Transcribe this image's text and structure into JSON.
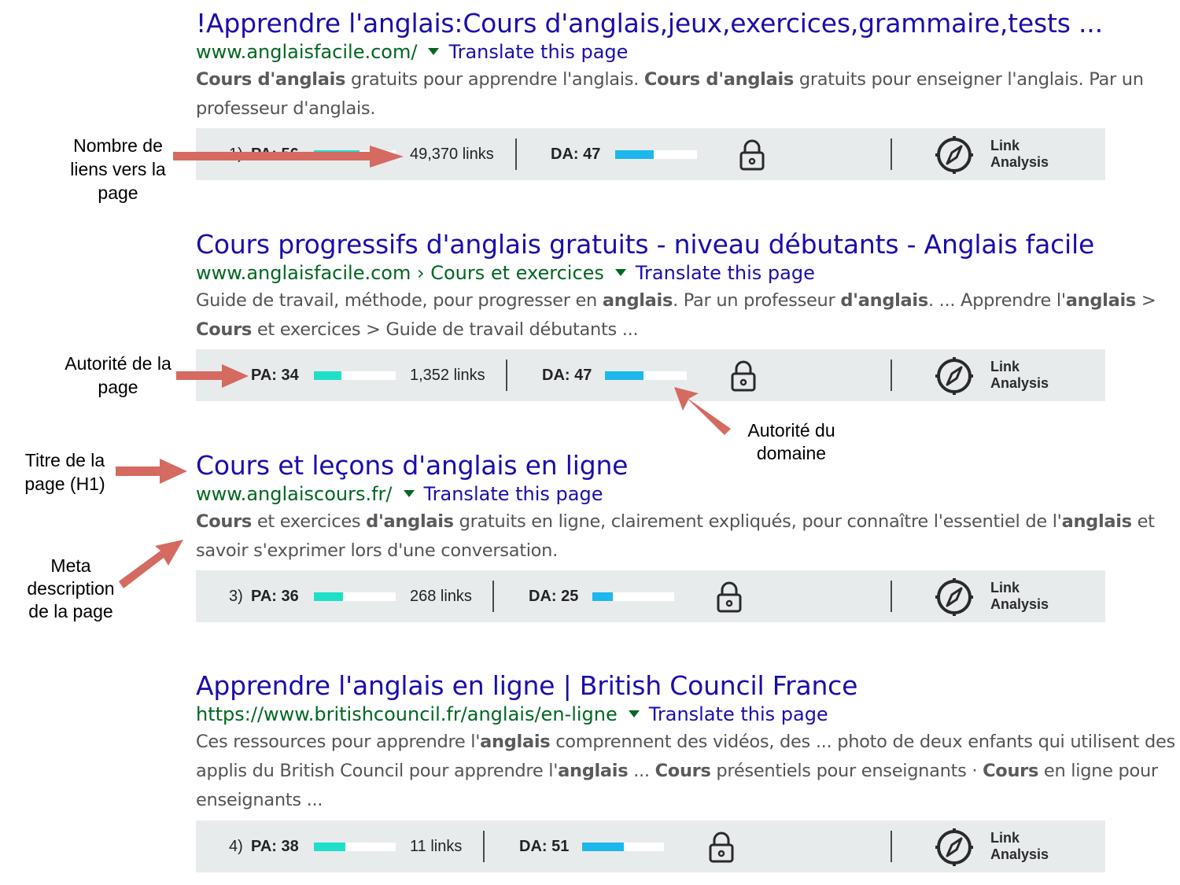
{
  "results": [
    {
      "title": "!Apprendre l'anglais:Cours d'anglais,jeux,exercices,grammaire,tests ...",
      "url": "www.anglaisfacile.com/",
      "translate": "Translate this page",
      "snippet_html": "<b>Cours d'anglais</b> gratuits pour apprendre l'anglais. <b>Cours d'anglais</b> gratuits pour enseigner l'anglais. Par un professeur d'anglais.",
      "mozbar": {
        "rank": "1)",
        "pa": "PA: 56",
        "pa_value": 56,
        "links": "49,370 links",
        "da": "DA: 47",
        "da_value": 47,
        "link_analysis": "Link Analysis"
      }
    },
    {
      "title": "Cours progressifs d'anglais gratuits - niveau débutants - Anglais facile",
      "url": "www.anglaisfacile.com › Cours et exercices",
      "translate": "Translate this page",
      "snippet_html": "Guide de travail, méthode, pour progresser en <b>anglais</b>. Par un professeur <b>d'anglais</b>. ... Apprendre l'<b>anglais</b> &gt; <b>Cours</b> et exercices &gt; Guide de travail débutants ...",
      "mozbar": {
        "rank": "",
        "pa": "PA: 34",
        "pa_value": 34,
        "links": "1,352 links",
        "da": "DA: 47",
        "da_value": 47,
        "link_analysis": "Link Analysis"
      }
    },
    {
      "title": "Cours et leçons d'anglais en ligne",
      "url": "www.anglaiscours.fr/",
      "translate": "Translate this page",
      "snippet_html": "<b>Cours</b> et exercices <b>d'anglais</b> gratuits en ligne, clairement expliqués, pour connaître l'essentiel de l'<b>anglais</b> et savoir s'exprimer lors d'une conversation.",
      "mozbar": {
        "rank": "3)",
        "pa": "PA: 36",
        "pa_value": 36,
        "links": "268 links",
        "da": "DA: 25",
        "da_value": 25,
        "link_analysis": "Link Analysis"
      }
    },
    {
      "title": "Apprendre l'anglais en ligne | British Council France",
      "url": "https://www.britishcouncil.fr/anglais/en-ligne",
      "translate": "Translate this page",
      "snippet_html": "Ces ressources pour apprendre l'<b>anglais</b> comprennent des vidéos, des ... photo de deux enfants qui utilisent des applis du British Council pour apprendre l'<b>anglais</b> ... <b>Cours</b> présentiels pour enseignants · <b>Cours</b> en ligne pour enseignants ...",
      "mozbar": {
        "rank": "4)",
        "pa": "PA: 38",
        "pa_value": 38,
        "links": "11 links",
        "da": "DA: 51",
        "da_value": 51,
        "link_analysis": "Link Analysis"
      }
    }
  ],
  "annotations": {
    "links": "Nombre de liens vers la page",
    "pa": "Autorité de la page",
    "da": "Autorité du domaine",
    "title": "Titre de la page (H1)",
    "meta": "Meta description de la page"
  },
  "colors": {
    "title_link": "#1a0dab",
    "url_green": "#006621",
    "snippet": "#545454",
    "mozbar_bg": "#e8ebec",
    "pa_fill": "#1ee0c8",
    "da_fill": "#1cb7ec",
    "annotation_arrow": "#d46a60"
  },
  "icons": [
    "triangle-down-icon",
    "lock-icon",
    "compass-icon",
    "arrow-icon"
  ]
}
